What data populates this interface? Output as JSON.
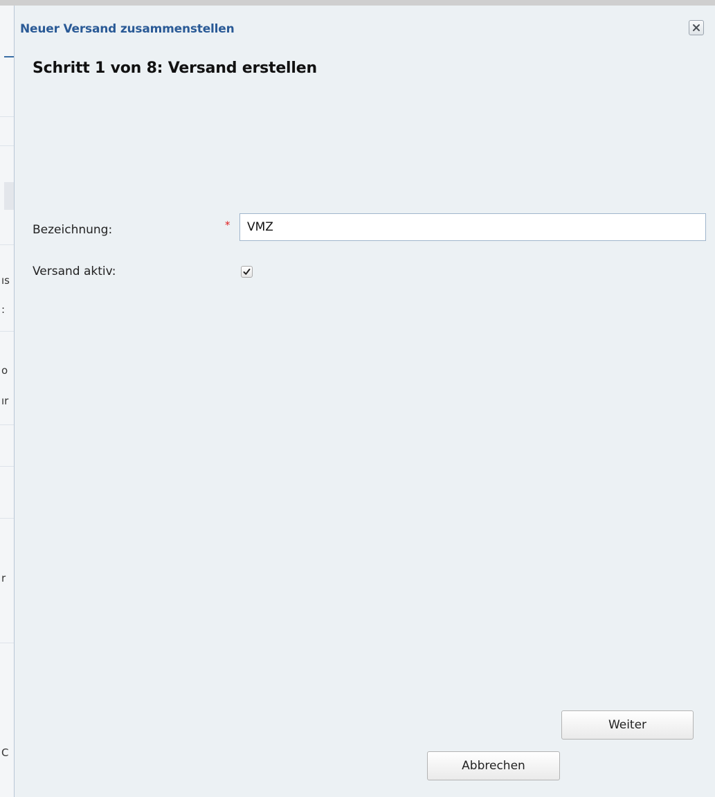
{
  "background_fragments": [
    "ıs",
    ":",
    "o",
    "ır",
    "r",
    "C"
  ],
  "dialog": {
    "title": "Neuer Versand zusammenstellen",
    "close_icon": "close-icon",
    "step_heading": "Schritt 1 von 8: Versand erstellen"
  },
  "form": {
    "name": {
      "label": "Bezeichnung:",
      "required_marker": "*",
      "value": "VMZ"
    },
    "active": {
      "label": "Versand aktiv:",
      "checked": true
    }
  },
  "buttons": {
    "next_label": "Weiter",
    "cancel_label": "Abbrechen"
  },
  "colors": {
    "title_blue": "#2a5a96",
    "dialog_bg": "#ecf1f4",
    "required_red": "#e02020"
  }
}
